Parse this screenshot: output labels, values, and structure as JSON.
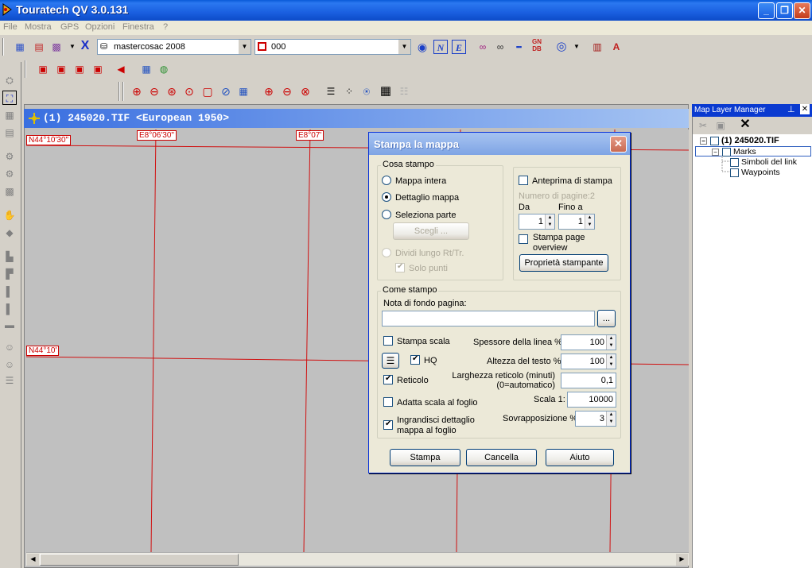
{
  "window": {
    "title": "Touratech QV 3.0.131"
  },
  "menu": [
    "File",
    "Mostra",
    "GPS",
    "Opzioni",
    "Finestra",
    "?"
  ],
  "toolbar": {
    "combo_map": "mastercosac 2008",
    "combo_layer": "000",
    "icons": [
      "map-open-icon",
      "map-layers-icon",
      "map-grid-icon",
      "delete-x-icon",
      "eye-icon",
      "north-icon",
      "east-icon",
      "binoculars-icon",
      "find-icon",
      "grid-dots-icon",
      "gndb-icon",
      "target-icon",
      "report-icon",
      "font-icon"
    ],
    "gndb_label": "GN DB"
  },
  "map_window": {
    "title": "(1) 245020.TIF <European 1950>",
    "coord_labels": {
      "lat_top": "N44°10'30\"",
      "lat_mid": "N44°10'",
      "lon_left": "E8°06'30\"",
      "lon_mid": "E8°07'"
    }
  },
  "layer_manager": {
    "title": "Map Layer Manager",
    "tree": {
      "root": "(1) 245020.TIF",
      "marks": "Marks",
      "child1": "Simboli del link",
      "child2": "Waypoints"
    }
  },
  "dialog": {
    "title": "Stampa la mappa",
    "cosa_stampo": {
      "label": "Cosa stampo",
      "mappa_intera": "Mappa intera",
      "dettaglio_mappa": "Dettaglio mappa",
      "seleziona_parte": "Seleziona parte",
      "scegli_button": "Scegli ...",
      "dividi": "Dividi lungo Rt/Tr.",
      "solo_punti": "Solo punti"
    },
    "anteprima": {
      "label": "Anteprima di stampa",
      "num_pagine": "Numero di pagine:2",
      "da_label": "Da",
      "da_value": "1",
      "fino_label": "Fino a",
      "fino_value": "1",
      "page_overview": "Stampa page overview",
      "proprieta_button": "Proprietà stampante"
    },
    "come_stampo": {
      "label": "Come stampo",
      "nota_label": "Nota di fondo pagina:",
      "nota_value": "",
      "browse_button": "...",
      "stampa_scala": "Stampa scala",
      "hq": "HQ",
      "reticolo": "Reticolo",
      "adatta_scala": "Adatta scala al foglio",
      "ingrandisci": "Ingrandisci dettaglio mappa al foglio",
      "spessore_label": "Spessore della linea %",
      "spessore_value": "100",
      "altezza_label": "Altezza del testo %",
      "altezza_value": "100",
      "larghezza_label": "Larghezza reticolo (minuti) (0=automatico)",
      "larghezza_value": "0,1",
      "scala_label": "Scala 1:",
      "scala_value": "10000",
      "sovrapposizione_label": "Sovrapposizione %",
      "sovrapposizione_value": "3"
    },
    "buttons": {
      "stampa": "Stampa",
      "cancella": "Cancella",
      "aiuto": "Aiuto"
    }
  },
  "colors": {
    "grid_line": "#d01010",
    "titlebar": "#1a5fe0",
    "dialog_bg": "#ece9d8"
  }
}
